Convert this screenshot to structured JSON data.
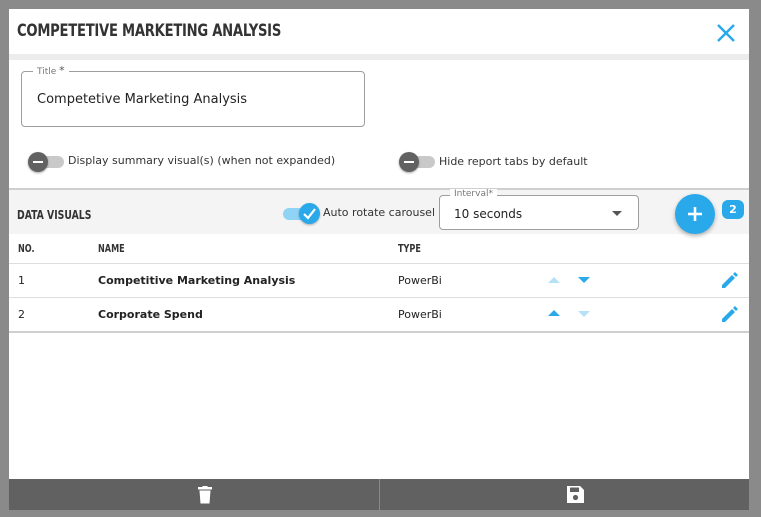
{
  "dialog": {
    "title": "COMPETETIVE MARKETING ANALYSIS",
    "close_icon": "close-icon"
  },
  "title_field": {
    "label": "Title",
    "required_mark": "*",
    "value": "Competetive Marketing Analysis"
  },
  "toggles": {
    "summary_label": "Display summary visual(s) (when not expanded)",
    "hide_tabs_label": "Hide report tabs by default"
  },
  "data_visuals": {
    "title": "DATA VISUALS",
    "auto_rotate_label": "Auto rotate carousel",
    "interval_label": "Interval*",
    "interval_value": "10 seconds",
    "count_badge": "2",
    "columns": {
      "no": "NO.",
      "name": "NAME",
      "type": "TYPE"
    },
    "rows": [
      {
        "no": "1",
        "name": "Competitive Marketing Analysis",
        "type": "PowerBi"
      },
      {
        "no": "2",
        "name": "Corporate Spend",
        "type": "PowerBi"
      }
    ]
  },
  "footer": {
    "delete_icon": "trash-icon",
    "save_icon": "save-icon"
  },
  "colors": {
    "accent": "#29a9ea",
    "footer": "#616161"
  }
}
